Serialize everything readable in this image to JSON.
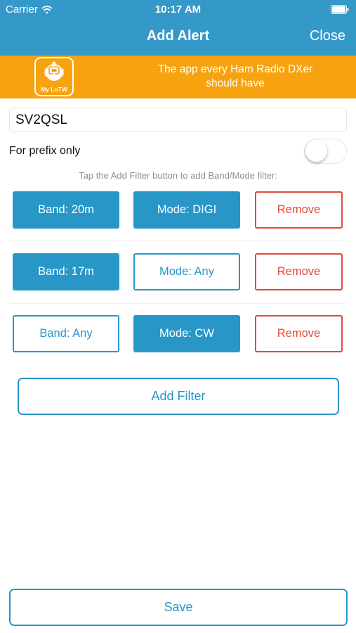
{
  "status_bar": {
    "carrier": "Carrier",
    "time": "10:17 AM"
  },
  "nav": {
    "title": "Add Alert",
    "close_label": "Close"
  },
  "banner": {
    "logo_text": "My LoTW",
    "tagline_line1": "The app every Ham Radio DXer",
    "tagline_line2": "should have"
  },
  "callsign_input": {
    "value": "SV2QSL"
  },
  "prefix_toggle": {
    "label": "For prefix only",
    "on": false
  },
  "hint": "Tap the Add Filter button to add Band/Mode filter:",
  "filters": [
    {
      "band": "Band: 20m",
      "band_selected": true,
      "mode": "Mode: DIGI",
      "mode_selected": true,
      "remove": "Remove"
    },
    {
      "band": "Band: 17m",
      "band_selected": true,
      "mode": "Mode: Any",
      "mode_selected": false,
      "remove": "Remove"
    },
    {
      "band": "Band: Any",
      "band_selected": false,
      "mode": "Mode: CW",
      "mode_selected": true,
      "remove": "Remove"
    }
  ],
  "add_filter_label": "Add Filter",
  "save_label": "Save",
  "colors": {
    "nav_blue": "#3498c9",
    "button_blue": "#2897c8",
    "banner_orange": "#f7a20f",
    "remove_red": "#e2493b"
  }
}
